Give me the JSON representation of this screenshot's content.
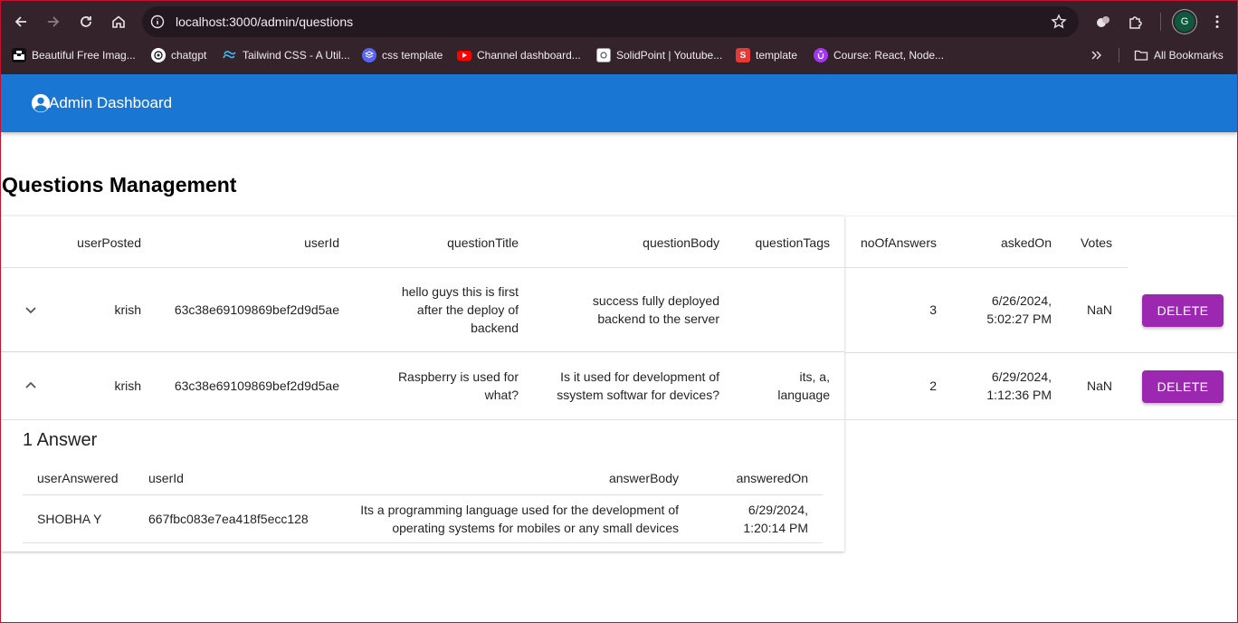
{
  "browser": {
    "url": "localhost:3000/admin/questions",
    "profile_initial": "G",
    "bookmarks": [
      {
        "label": "Beautiful Free Imag...",
        "icon": "unsplash-icon",
        "color": "#111111"
      },
      {
        "label": "chatgpt",
        "icon": "chatgpt-icon",
        "color": "#ffffff"
      },
      {
        "label": "Tailwind CSS - A Util...",
        "icon": "tailwind-icon",
        "color": "#38bdf8"
      },
      {
        "label": "css template",
        "icon": "layers-icon",
        "color": "#5865f2"
      },
      {
        "label": "Channel dashboard...",
        "icon": "youtube-icon",
        "color": "#ff0000"
      },
      {
        "label": "SolidPoint | Youtube...",
        "icon": "solidpoint-icon",
        "color": "#ffffff"
      },
      {
        "label": "template",
        "icon": "s-icon",
        "color": "#e53935"
      },
      {
        "label": "Course: React, Node...",
        "icon": "udemy-icon",
        "color": "#a435f0"
      }
    ],
    "all_bookmarks_label": "All Bookmarks"
  },
  "app": {
    "title": "Admin Dashboard",
    "primary_color": "#1976d2",
    "delete_color": "#9c27b0"
  },
  "page": {
    "title": "Questions Management"
  },
  "table": {
    "headers": [
      "userPosted",
      "userId",
      "questionTitle",
      "questionBody",
      "questionTags",
      "noOfAnswers",
      "askedOn",
      "Votes"
    ],
    "rows": [
      {
        "userPosted": "krish",
        "userId": "63c38e69109869bef2d9d5ae",
        "questionTitle": [
          "hello guys this is first",
          "after the deploy of",
          "backend"
        ],
        "questionBody": [
          "success fully deployed",
          "backend to the server"
        ],
        "questionTags": [],
        "noOfAnswers": "3",
        "askedOn": [
          "6/26/2024,",
          "5:02:27 PM"
        ],
        "votes": "NaN",
        "expanded": false,
        "delete_label": "DELETE"
      },
      {
        "userPosted": "krish",
        "userId": "63c38e69109869bef2d9d5ae",
        "questionTitle": [
          "Raspberry is used for",
          "what?"
        ],
        "questionBody": [
          "Is it used for development of",
          "ssystem softwar for devices?"
        ],
        "questionTags": [
          "its, a,",
          "language"
        ],
        "noOfAnswers": "2",
        "askedOn": [
          "6/29/2024,",
          "1:12:36 PM"
        ],
        "votes": "NaN",
        "expanded": true,
        "delete_label": "DELETE"
      }
    ]
  },
  "answers": {
    "title": "1 Answer",
    "headers": [
      "userAnswered",
      "userId",
      "answerBody",
      "answeredOn"
    ],
    "rows": [
      {
        "userAnswered": "SHOBHA Y",
        "userId": "667fbc083e7ea418f5ecc128",
        "answerBody": [
          "Its a programming language used for the development of",
          "operating systems for mobiles or any small devices"
        ],
        "answeredOn": [
          "6/29/2024,",
          "1:20:14 PM"
        ]
      }
    ]
  }
}
